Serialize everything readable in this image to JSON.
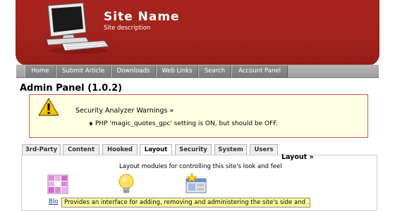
{
  "header": {
    "site_name": "Site Name",
    "site_description": "Site description",
    "logo_icon": "computer-icon"
  },
  "nav": {
    "items": [
      "Home",
      "Submit Article",
      "Downloads",
      "Web Links",
      "Search",
      "Account Panel"
    ]
  },
  "admin": {
    "title": "Admin Panel (1.0.2)"
  },
  "warning": {
    "icon": "warning-icon",
    "title": "Security Analyzer Warnings »",
    "bullet": "♦",
    "message": "PHP 'magic_quotes_gpc' setting is ON, but should be OFF."
  },
  "tabs": {
    "items": [
      "3rd-Party",
      "Content",
      "Hooked",
      "Layout",
      "Security",
      "System",
      "Users"
    ],
    "active": "Layout"
  },
  "section": {
    "title": "Layout »",
    "description": "Layout modules for controlling this site's look and feel"
  },
  "modules": {
    "first_label": "Blo",
    "tooltip": "Provides an interface for adding, removing and administering the site's side and ..."
  },
  "colors": {
    "header_red": "#a2221c",
    "nav_gray": "#9e9e9e",
    "warning_bg": "#ffffe3",
    "warning_border": "#c65a5a",
    "tooltip_bg": "#ffff99"
  }
}
